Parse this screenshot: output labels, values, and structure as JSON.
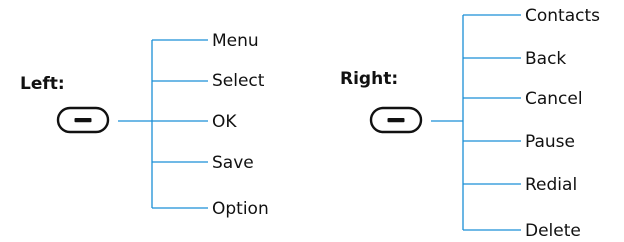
{
  "left": {
    "label": "Left:",
    "key_icon": "minus-key-icon",
    "items": [
      "Menu",
      "Select",
      "OK",
      "Save",
      "Option"
    ]
  },
  "right": {
    "label": "Right:",
    "key_icon": "minus-key-icon",
    "items": [
      "Contacts",
      "Back",
      "Cancel",
      "Pause",
      "Redial",
      "Delete"
    ]
  },
  "colors": {
    "connector": "#1b8fd6",
    "text": "#111111"
  }
}
